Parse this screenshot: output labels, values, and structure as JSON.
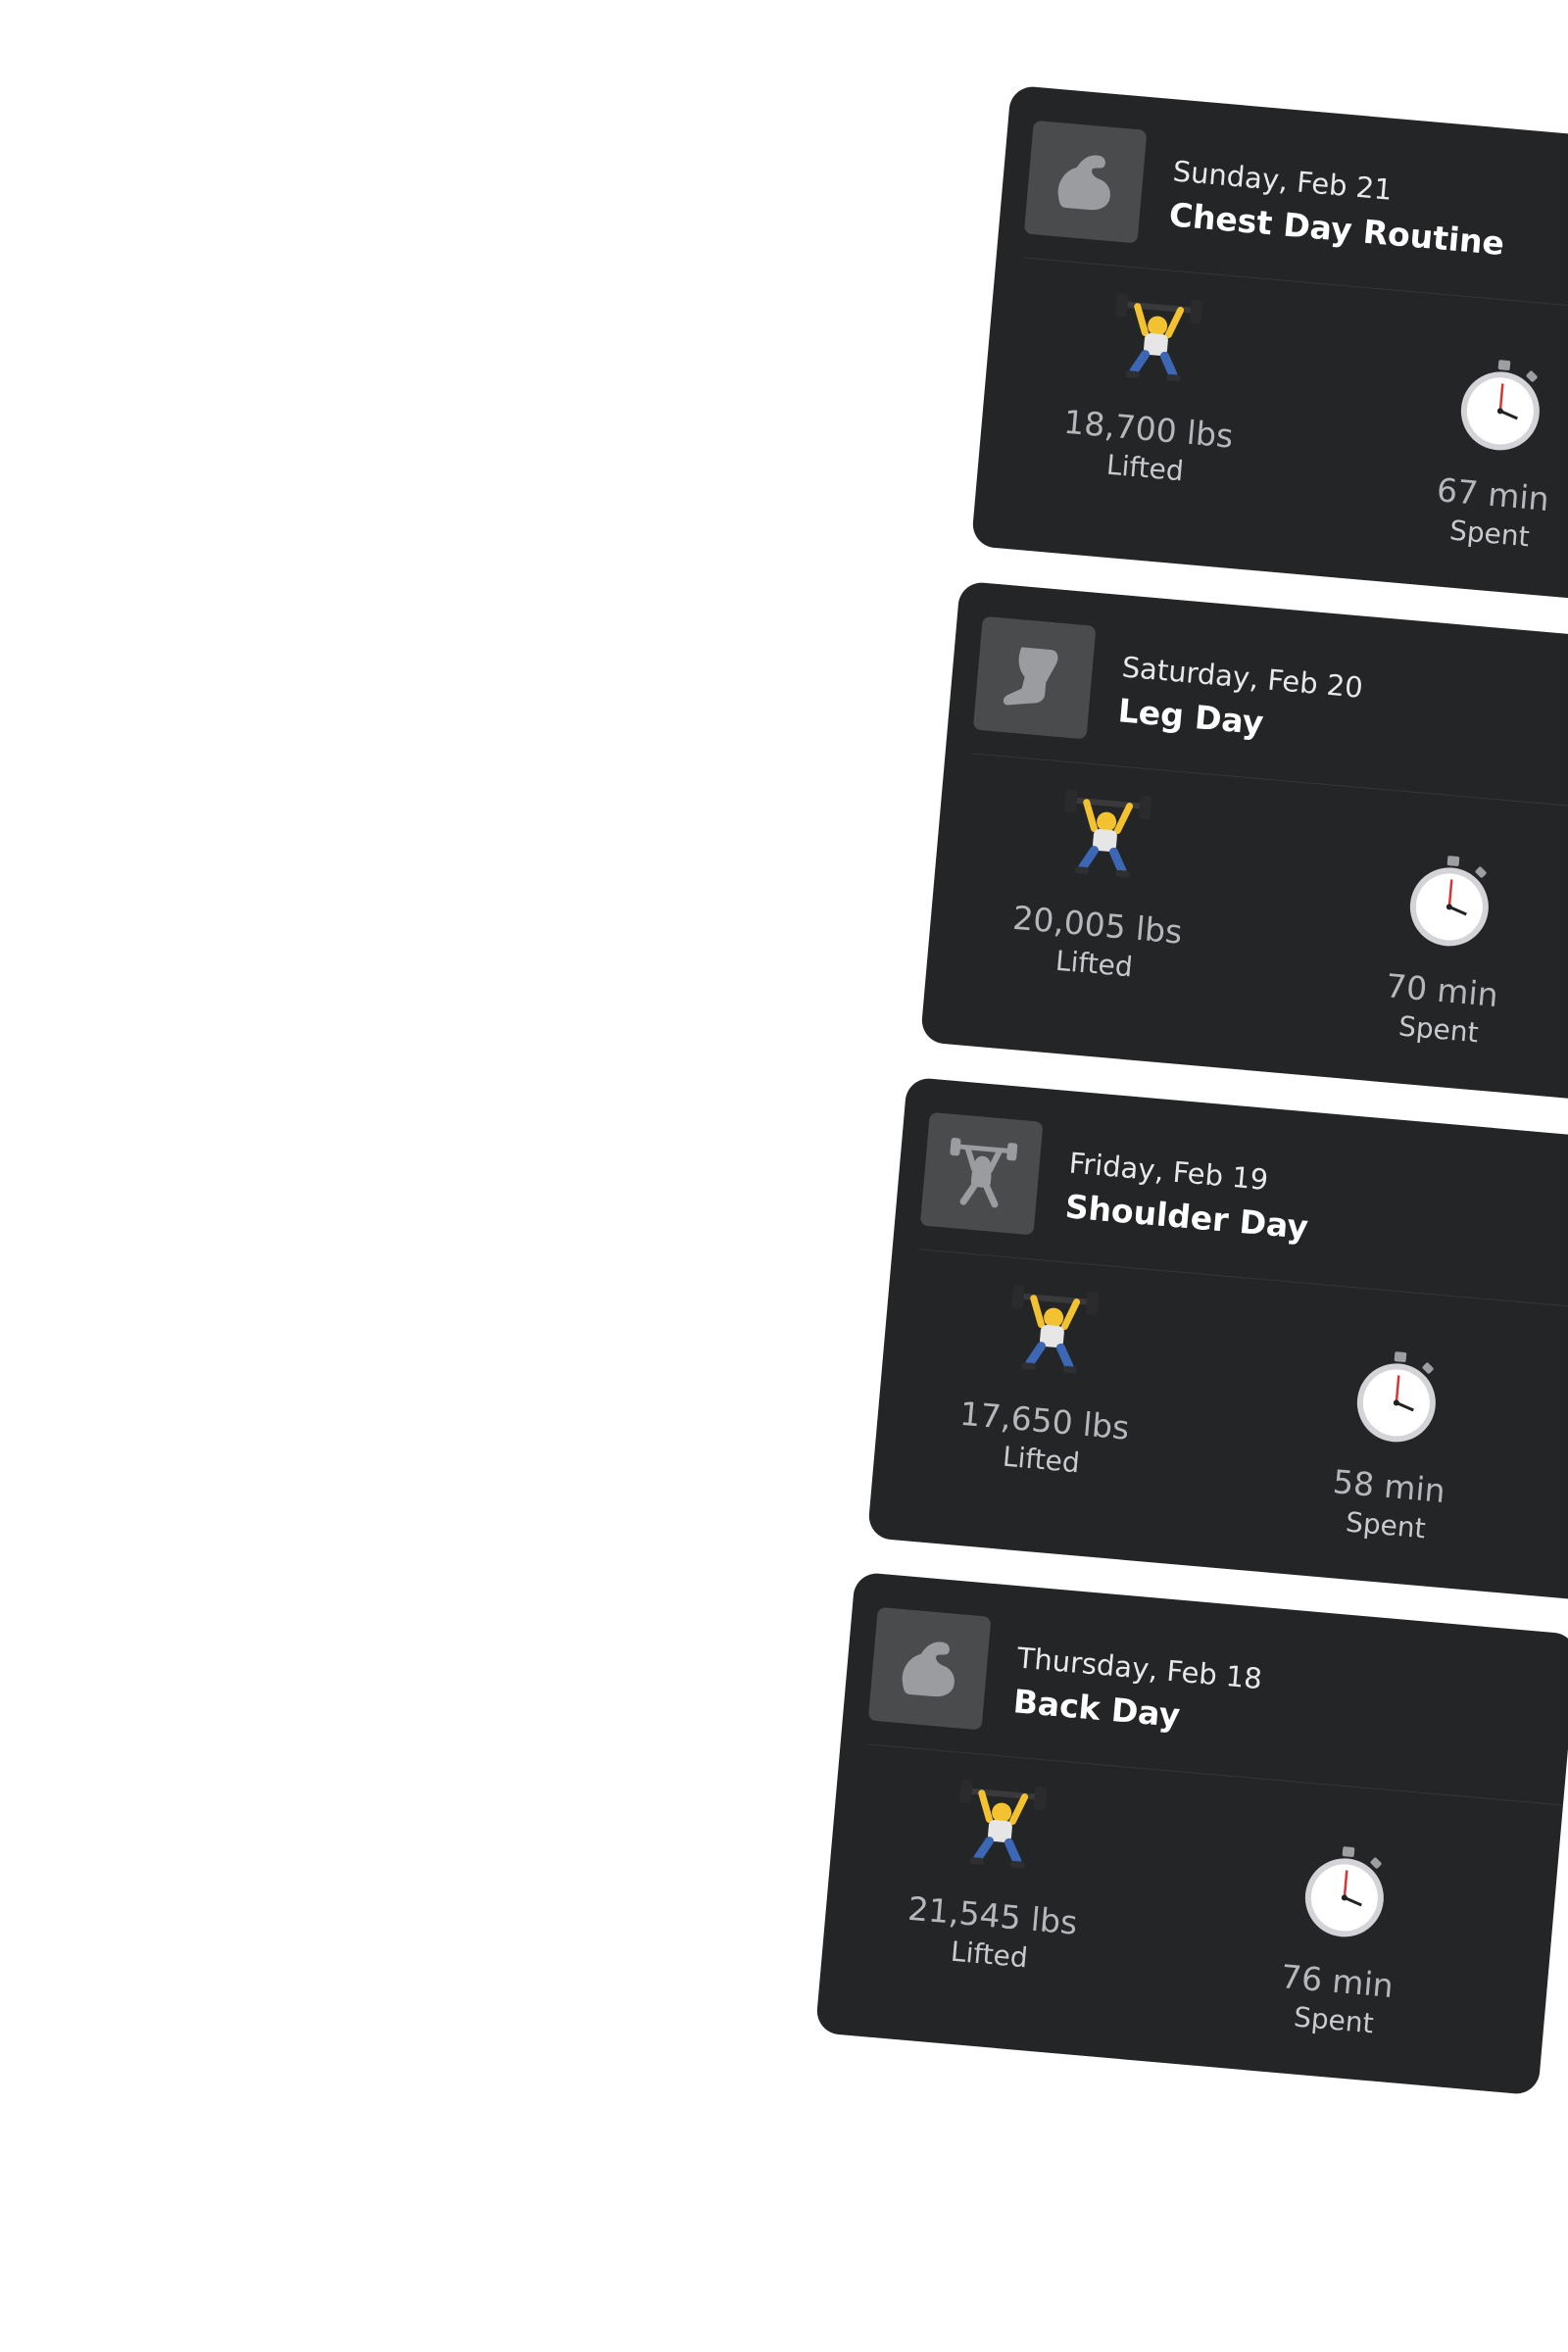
{
  "workouts": [
    {
      "date": "Sunday, Feb 21",
      "title": "Chest Day Routine",
      "icon": "flexed-arm-icon",
      "lifted_value": "18,700 lbs",
      "lifted_label": "Lifted",
      "time_value": "67 min",
      "time_label": "Spent"
    },
    {
      "date": "Saturday, Feb 20",
      "title": "Leg Day",
      "icon": "leg-icon",
      "lifted_value": "20,005 lbs",
      "lifted_label": "Lifted",
      "time_value": "70 min",
      "time_label": "Spent"
    },
    {
      "date": "Friday, Feb 19",
      "title": "Shoulder Day",
      "icon": "weightlifter-icon",
      "lifted_value": "17,650 lbs",
      "lifted_label": "Lifted",
      "time_value": "58 min",
      "time_label": "Spent"
    },
    {
      "date": "Thursday, Feb 18",
      "title": "Back Day",
      "icon": "flexed-arm-icon",
      "lifted_value": "21,545 lbs",
      "lifted_label": "Lifted",
      "time_value": "76 min",
      "time_label": "Spent"
    }
  ],
  "colors": {
    "card_background": "#242527",
    "thumb_background": "#4a4b4d",
    "title_text": "#ffffff",
    "value_text": "#b6b7bb"
  }
}
